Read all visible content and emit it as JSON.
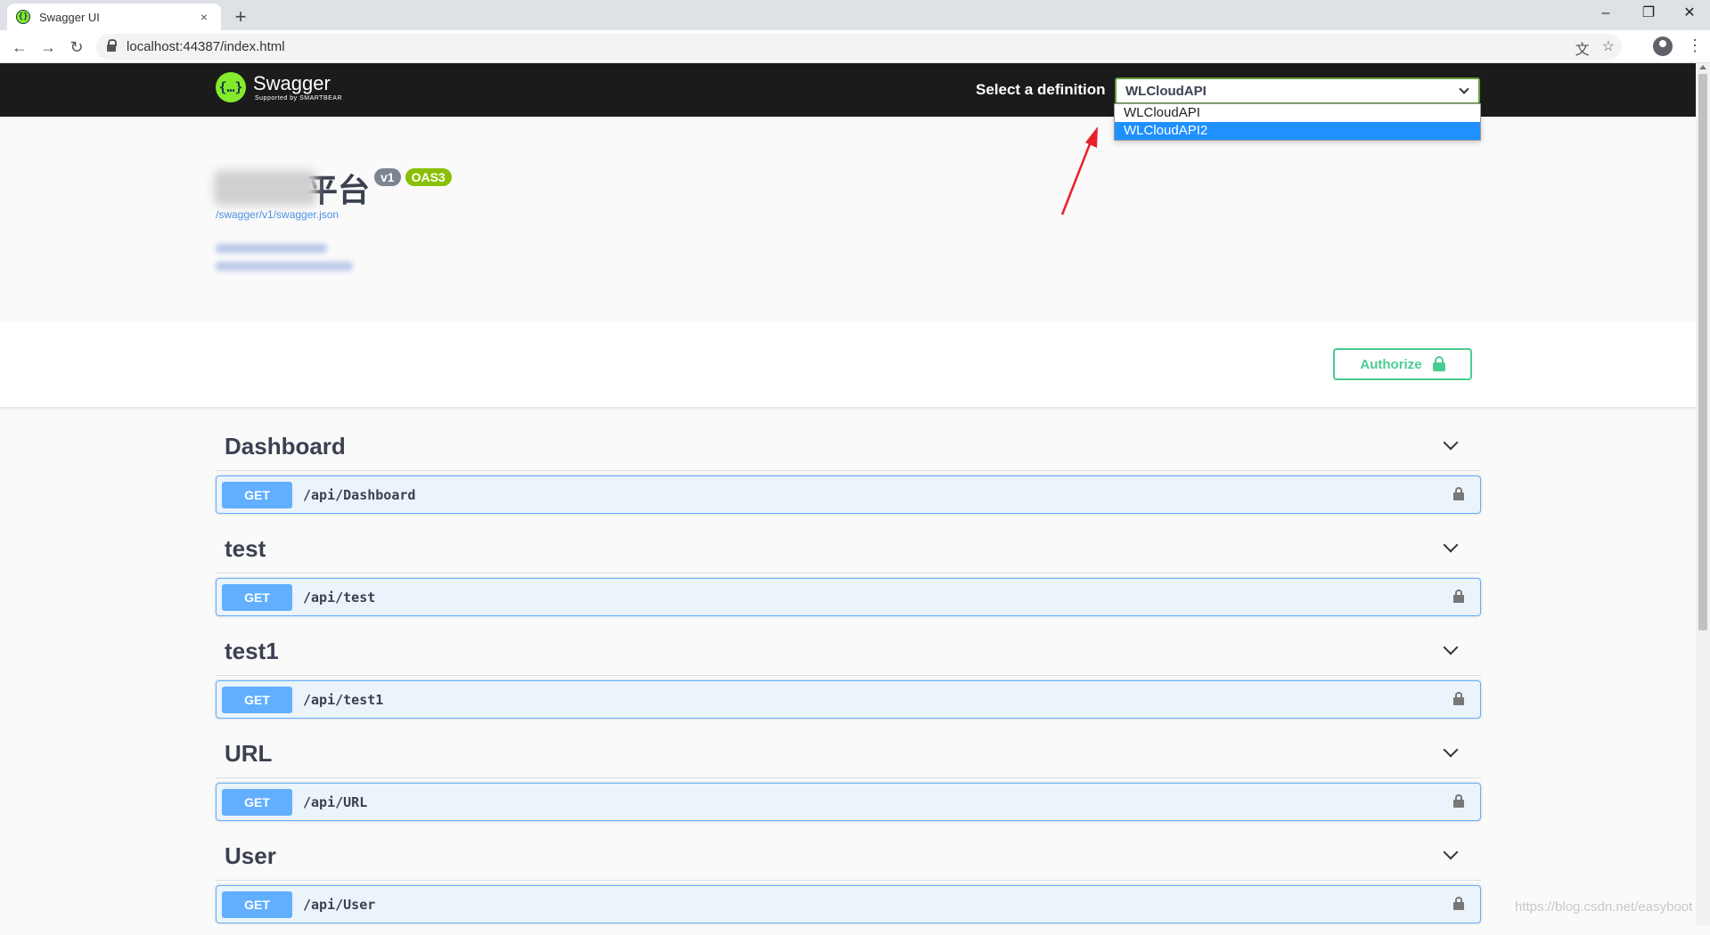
{
  "browser": {
    "tab_title": "Swagger UI",
    "tab_close": "×",
    "new_tab": "+",
    "url": "localhost:44387/index.html",
    "win_min": "–",
    "win_max": "❐",
    "win_close": "✕",
    "back": "←",
    "forward": "→",
    "reload": "↻",
    "translate_icon": "文",
    "star_icon": "☆",
    "menu_icon": "⋮"
  },
  "topbar": {
    "logo_name": "Swagger",
    "logo_sub": "Supported by SMARTBEAR",
    "logo_glyph": "{…}",
    "select_label": "Select a definition",
    "selected": "WLCloudAPI",
    "options": [
      "WLCloudAPI",
      "WLCloudAPI2"
    ],
    "highlighted_option": "WLCloudAPI2"
  },
  "info": {
    "title_visible": "平台",
    "version": "v1",
    "oas": "OAS3",
    "spec_url": "/swagger/v1/swagger.json"
  },
  "scheme": {
    "authorize_label": "Authorize"
  },
  "tags": [
    {
      "name": "Dashboard",
      "method": "GET",
      "path": "/api/Dashboard"
    },
    {
      "name": "test",
      "method": "GET",
      "path": "/api/test"
    },
    {
      "name": "test1",
      "method": "GET",
      "path": "/api/test1"
    },
    {
      "name": "URL",
      "method": "GET",
      "path": "/api/URL"
    },
    {
      "name": "User",
      "method": "GET",
      "path": "/api/User"
    }
  ],
  "watermark": "https://blog.csdn.net/easyboot",
  "colors": {
    "get": "#61affe",
    "authorize": "#49cc90",
    "select_border": "#62a03f",
    "dropdown_highlight": "#1e90ff",
    "annotation_arrow": "#e8202a"
  }
}
